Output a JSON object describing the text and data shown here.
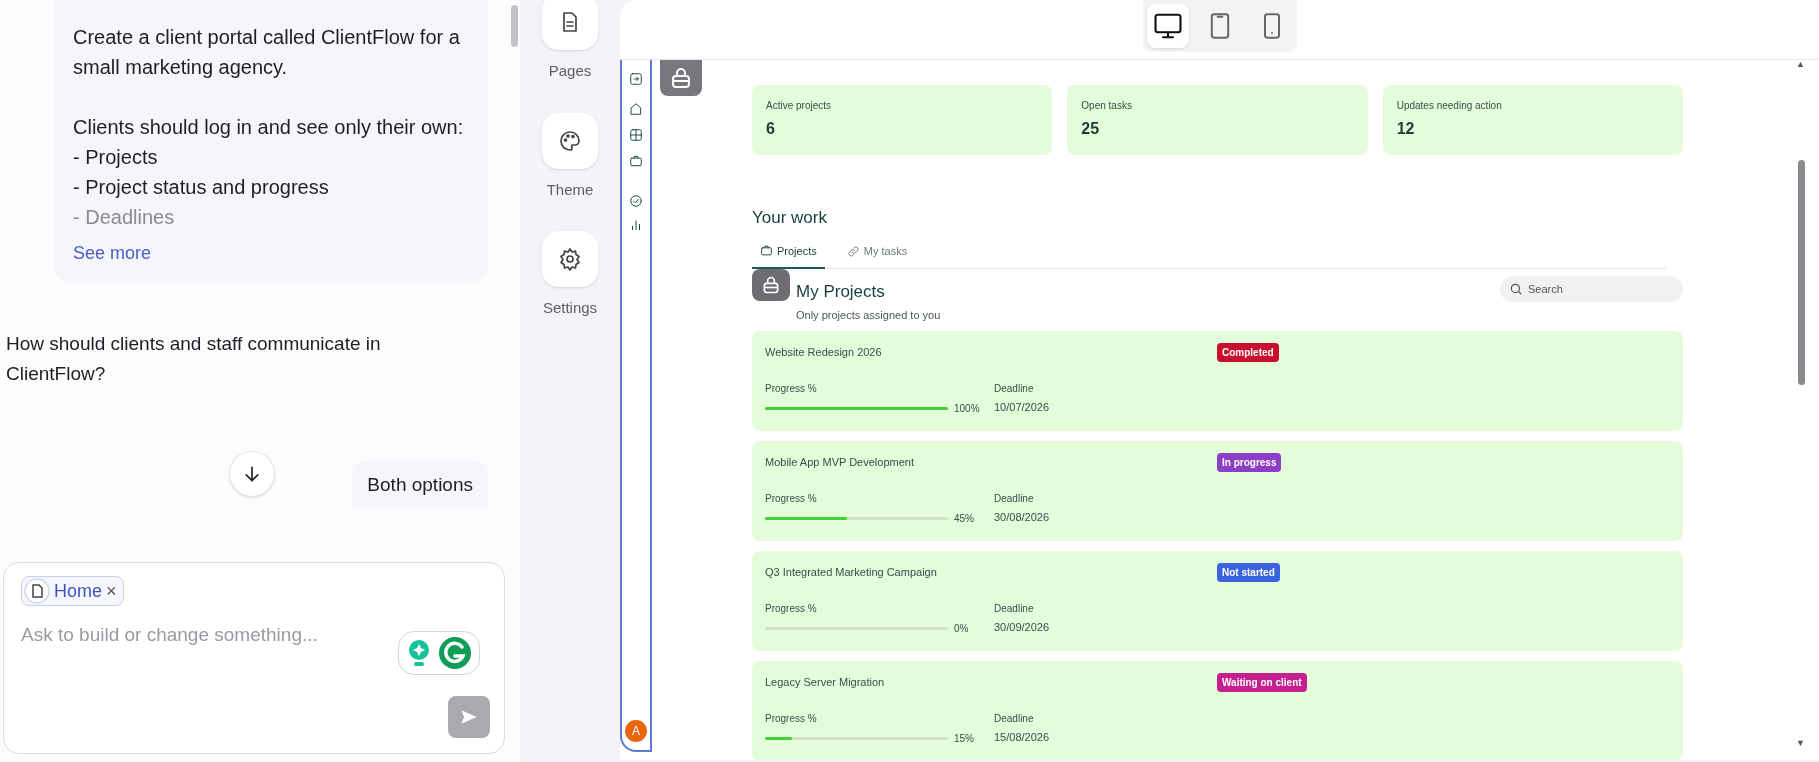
{
  "chat": {
    "prompt_intro": "Create a client portal called ClientFlow for a small marketing agency.",
    "prompt_lines": [
      "Clients should log in and see only their own:",
      "- Projects",
      "- Project status and progress"
    ],
    "prompt_faded_line": "- Deadlines",
    "see_more": "See more",
    "assistant_message": "How should clients and staff communicate in ClientFlow?",
    "user_reply": "Both options"
  },
  "composer": {
    "chip": "Home",
    "chip_close": "×",
    "placeholder": "Ask to build or change something..."
  },
  "tools": [
    {
      "kind": "pages",
      "label": "Pages"
    },
    {
      "kind": "theme",
      "label": "Theme"
    },
    {
      "kind": "settings",
      "label": "Settings"
    }
  ],
  "devices": [
    {
      "kind": "desktop",
      "selected": true
    },
    {
      "kind": "tablet",
      "selected": false
    },
    {
      "kind": "phone",
      "selected": false
    }
  ],
  "preview": {
    "nav_icons": [
      {
        "kind": "expand"
      },
      {
        "kind": "home"
      },
      {
        "kind": "grid"
      },
      {
        "kind": "briefcase"
      },
      {
        "kind": "check"
      },
      {
        "kind": "chart"
      }
    ],
    "avatar": "A",
    "scroll_up": "▲",
    "scroll_down": "▼",
    "stats": [
      {
        "label": "Active projects",
        "value": "6"
      },
      {
        "label": "Open tasks",
        "value": "25"
      },
      {
        "label": "Updates needing action",
        "value": "12"
      }
    ],
    "section_title": "Your work",
    "tabs": [
      {
        "kind": "briefcase",
        "label": "Projects",
        "selected": true
      },
      {
        "kind": "link",
        "label": "My tasks",
        "selected": false
      }
    ],
    "list_title": "My Projects",
    "list_subtitle": "Only projects assigned to you",
    "search_placeholder": "Search",
    "projects": [
      {
        "name": "Website Redesign 2026",
        "status": "Completed",
        "color": "#c8102e",
        "progress_label": "Progress %",
        "level": 1,
        "percent": "100%",
        "deadline_label": "Deadline",
        "deadline": "10/07/2026"
      },
      {
        "name": "Mobile App MVP Development",
        "status": "In progress",
        "color": "#8b3fc6",
        "progress_label": "Progress %",
        "level": 0.45,
        "percent": "45%",
        "deadline_label": "Deadline",
        "deadline": "30/08/2026"
      },
      {
        "name": "Q3 Integrated Marketing Campaign",
        "status": "Not started",
        "color": "#3b63e0",
        "progress_label": "Progress %",
        "level": 0,
        "percent": "0%",
        "deadline_label": "Deadline",
        "deadline": "30/09/2026"
      },
      {
        "name": "Legacy Server Migration",
        "status": "Waiting on client",
        "color": "#c4208f",
        "progress_label": "Progress %",
        "level": 0.15,
        "percent": "15%",
        "deadline_label": "Deadline",
        "deadline": "15/08/2026"
      }
    ]
  }
}
